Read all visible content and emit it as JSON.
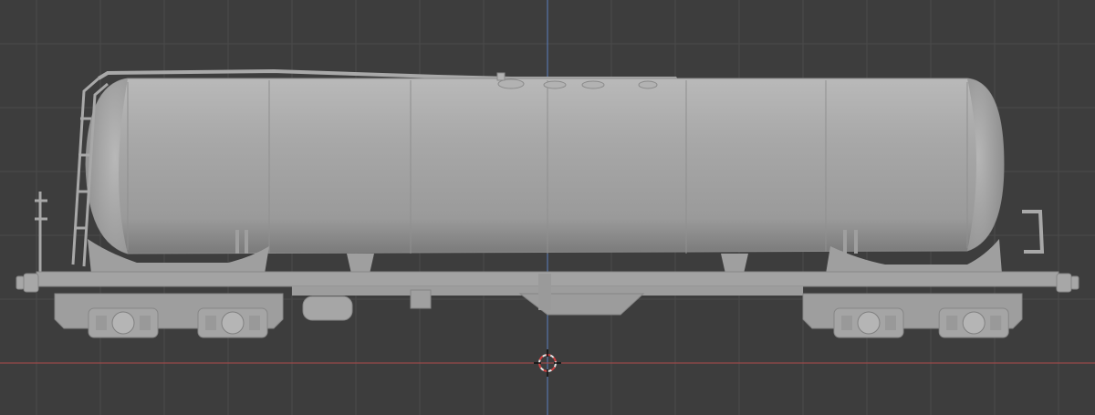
{
  "viewport": {
    "background_color": "#3d3d3d",
    "grid_color": "#4a4a4a",
    "x_axis_color": "#b04a4a",
    "z_axis_color": "#5a7fc0",
    "model_color": "#a6a6a6",
    "model_shadow_color": "#7c7c7c",
    "model_highlight_color": "#c4c4c4"
  },
  "model": {
    "name": "tank-wagon",
    "icon": "3d-cursor-icon"
  }
}
